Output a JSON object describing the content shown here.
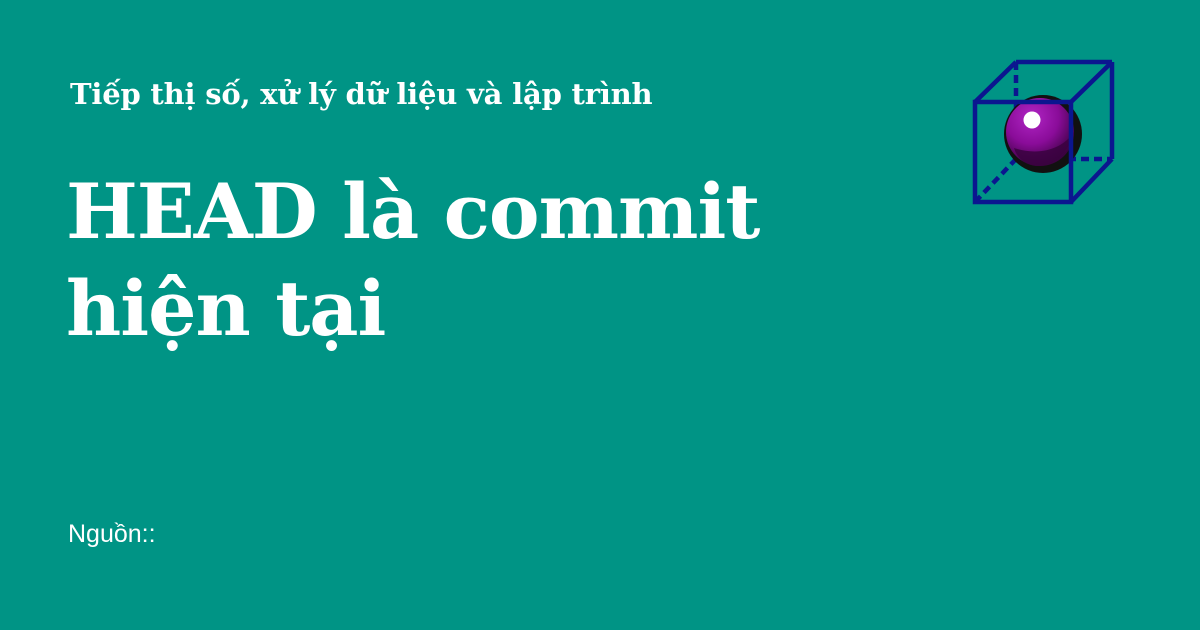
{
  "card": {
    "subtitle": "Tiếp thị số, xử lý dữ liệu và lập trình",
    "title": "HEAD là commit hiện tại",
    "source_label": "Nguồn::"
  },
  "logo": {
    "icon": "cube-with-sphere-icon"
  },
  "colors": {
    "background": "#009485",
    "text": "#ffffff",
    "cube_stroke": "#0b168f",
    "sphere": "#8a0c99"
  }
}
